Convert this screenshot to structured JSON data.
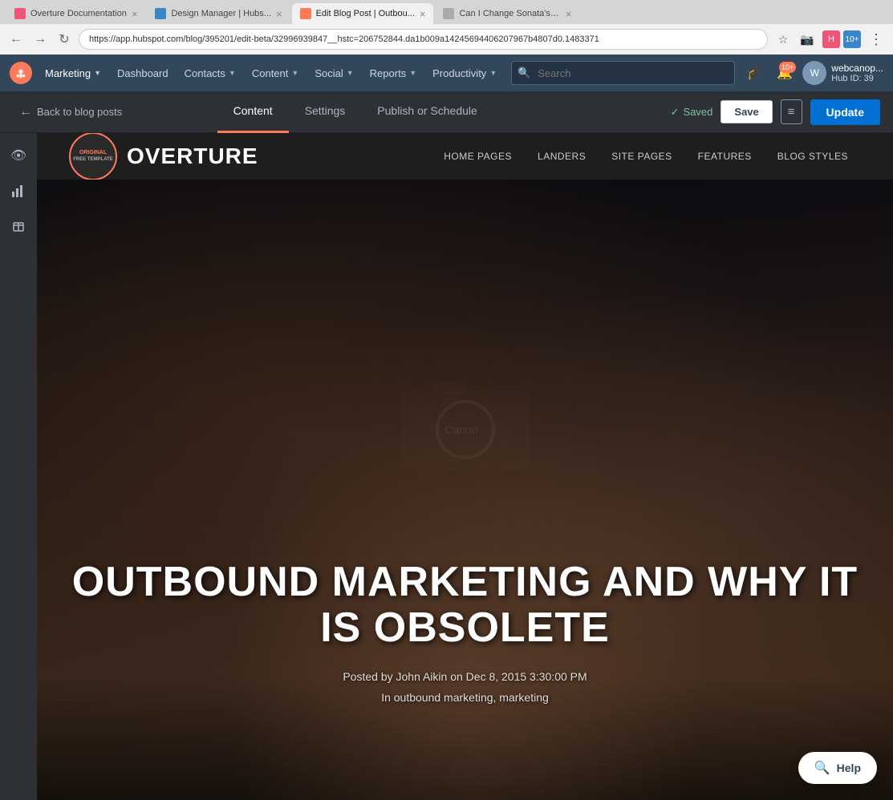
{
  "browser": {
    "tabs": [
      {
        "id": "tab1",
        "title": "Overture Documentation",
        "active": false,
        "favicon_color": "#e57"
      },
      {
        "id": "tab2",
        "title": "Design Manager | Hubs...",
        "active": false,
        "favicon_color": "#3b86c8"
      },
      {
        "id": "tab3",
        "title": "Edit Blog Post | Outbou...",
        "active": true,
        "favicon_color": "#ff7a59"
      },
      {
        "id": "tab4",
        "title": "Can I Change Sonata's L...",
        "active": false,
        "favicon_color": "#aaa"
      }
    ],
    "address": "https://app.hubspot.com/blog/395201/edit-beta/32996939847__hstc=206752844.da1b009a14245694406207967b4807d0.1483371"
  },
  "topnav": {
    "brand": "Marketing",
    "items": [
      {
        "label": "Dashboard",
        "has_dropdown": false
      },
      {
        "label": "Contacts",
        "has_dropdown": true
      },
      {
        "label": "Content",
        "has_dropdown": true
      },
      {
        "label": "Social",
        "has_dropdown": true
      },
      {
        "label": "Reports",
        "has_dropdown": true
      },
      {
        "label": "Productivity",
        "has_dropdown": true
      }
    ],
    "search_placeholder": "Search",
    "notification_count": "10+",
    "user_initials": "W",
    "user_name": "webcanop...",
    "hub_id": "Hub ID: 39"
  },
  "editbar": {
    "back_label": "Back to blog posts",
    "tabs": [
      {
        "id": "content",
        "label": "Content",
        "active": true
      },
      {
        "id": "settings",
        "label": "Settings",
        "active": false
      },
      {
        "id": "publish",
        "label": "Publish or Schedule",
        "active": false
      }
    ],
    "saved_label": "Saved",
    "save_btn_label": "Save",
    "update_btn_label": "Update"
  },
  "themenav": {
    "logo_badge_top": "FREE TEMPLATE",
    "logo_name": "OVERTURE",
    "links": [
      {
        "label": "HOME PAGES"
      },
      {
        "label": "LANDERS"
      },
      {
        "label": "SITE PAGES"
      },
      {
        "label": "FEATURES"
      },
      {
        "label": "BLOG STYLES"
      }
    ]
  },
  "hero": {
    "title": "OUTBOUND MARKETING AND WHY IT IS OBSOLETE",
    "meta": "Posted by John Aikin on Dec 8, 2015 3:30:00 PM",
    "tags": "In outbound marketing, marketing"
  },
  "help": {
    "label": "Help"
  }
}
